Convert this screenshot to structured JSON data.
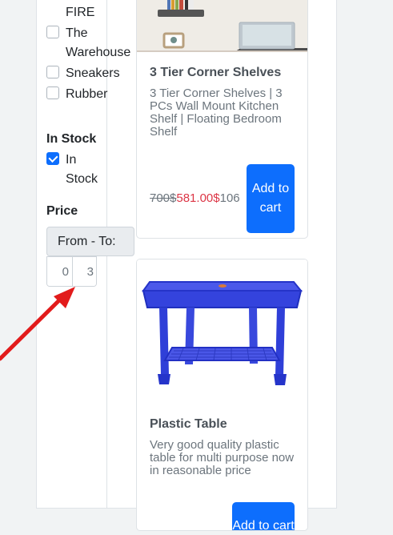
{
  "filters": {
    "brands": [
      {
        "label": "FIRE",
        "checked": false
      },
      {
        "label": "The Warehouse",
        "checked": false
      },
      {
        "label": "Sneakers",
        "checked": false
      },
      {
        "label": "Rubber",
        "checked": false
      }
    ],
    "stock": {
      "title": "In Stock",
      "option_label": "In Stock",
      "checked": true
    },
    "price": {
      "title": "Price",
      "range_label": "From - To:",
      "from_value": "0",
      "to_value": "3"
    }
  },
  "products": [
    {
      "title": "3 Tier Corner Shelves",
      "description": "3 Tier Corner Shelves | 3 PCs Wall Mount Kitchen Shelf | Floating Bedroom Shelf",
      "old_price": "700$",
      "new_price": "581.00$",
      "extra_price": "106",
      "cart_label": "Add to cart"
    },
    {
      "title": "Plastic Table",
      "description": "Very good quality plastic table for multi purpose now in reasonable price",
      "cart_label": "Add to cart"
    }
  ],
  "colors": {
    "accent": "#0d6efd",
    "sale_price": "#dc3545",
    "annotation_arrow": "#e21b1b",
    "table_blue": "#2f3fd8"
  }
}
